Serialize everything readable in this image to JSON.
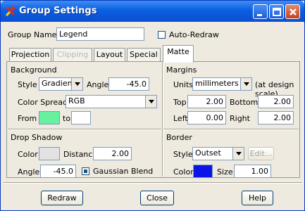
{
  "window": {
    "title": "Group Settings",
    "icon": "tools-icon"
  },
  "header": {
    "group_name_label": "Group Name:",
    "group_name_value": "Legend",
    "auto_redraw_label": "Auto-Redraw",
    "auto_redraw_checked": false
  },
  "tabs": [
    {
      "label": "Projection",
      "enabled": true,
      "active": false
    },
    {
      "label": "Clipping",
      "enabled": false,
      "active": false
    },
    {
      "label": "Layout",
      "enabled": true,
      "active": false
    },
    {
      "label": "Special",
      "enabled": true,
      "active": false
    },
    {
      "label": "Matte",
      "enabled": true,
      "active": true
    }
  ],
  "background": {
    "title": "Background",
    "style_label": "Style",
    "style_value": "Gradient",
    "angle_label": "Angle",
    "angle_value": "-45.0",
    "color_spread_label": "Color Spread",
    "color_spread_value": "RGB",
    "from_label": "From",
    "to_label": "to",
    "from_color": "#66f0a0",
    "to_color": "#ffffff"
  },
  "drop_shadow": {
    "title": "Drop Shadow",
    "color_label": "Color",
    "color_value": "#e2e2e2",
    "distance_label": "Distance",
    "distance_value": "2.00",
    "angle_label": "Angle",
    "angle_value": "-45.0",
    "gaussian_label": "Gaussian Blend",
    "gaussian_checked": true
  },
  "margins": {
    "title": "Margins",
    "units_label": "Units",
    "units_value": "millimeters",
    "units_note": "(at design scale)",
    "top_label": "Top",
    "top_value": "2.00",
    "bottom_label": "Bottom",
    "bottom_value": "2.00",
    "left_label": "Left",
    "left_value": "0.00",
    "right_label": "Right",
    "right_value": "2.00"
  },
  "border": {
    "title": "Border",
    "style_label": "Style",
    "style_value": "Outset",
    "edit_label": "Edit...",
    "color_label": "Color",
    "color_value": "#0a14e6",
    "size_label": "Size",
    "size_value": "1.00"
  },
  "footer": {
    "redraw_label": "Redraw",
    "close_label": "Close",
    "help_label": "Help"
  }
}
